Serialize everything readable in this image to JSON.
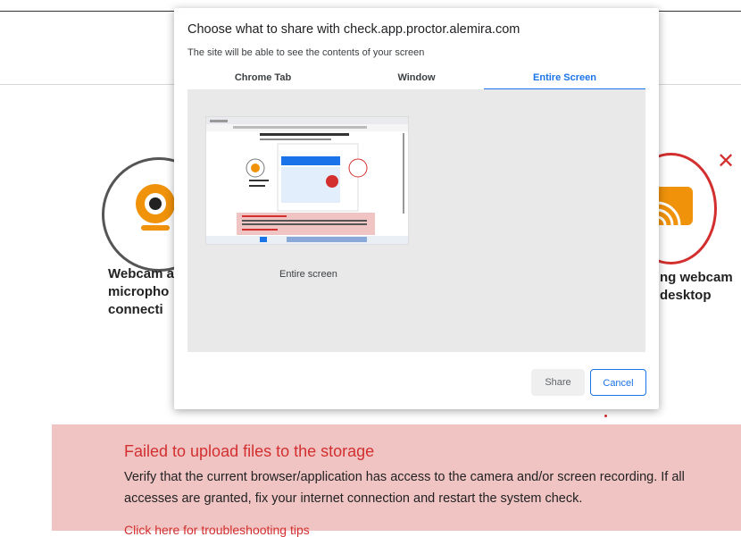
{
  "dialog": {
    "title": "Choose what to share with check.app.proctor.alemira.com",
    "subtitle": "The site will be able to see the contents of your screen",
    "tabs": [
      {
        "label": "Chrome Tab",
        "active": false
      },
      {
        "label": "Window",
        "active": false
      },
      {
        "label": "Entire Screen",
        "active": true
      }
    ],
    "thumbnail_label": "Entire screen",
    "share_label": "Share",
    "cancel_label": "Cancel"
  },
  "page": {
    "left_item": {
      "line1": "Webcam a",
      "line2": "micropho",
      "line3": "connecti",
      "icon": "webcam-icon"
    },
    "right_item": {
      "line1": "ng webcam",
      "line2": "desktop",
      "icon": "screen-cast-icon",
      "status_icon": "close-icon"
    }
  },
  "error": {
    "title": "Failed to upload files to the storage",
    "body": "Verify that the current browser/application has access to the camera and/or screen recording. If all accesses are granted, fix your internet connection and restart the system check.",
    "link": "Click here for troubleshooting tips"
  },
  "colors": {
    "accent_blue": "#1a73e8",
    "error_red": "#d32f2f",
    "error_bg": "#f1c4c4",
    "icon_orange": "#f0920a"
  }
}
